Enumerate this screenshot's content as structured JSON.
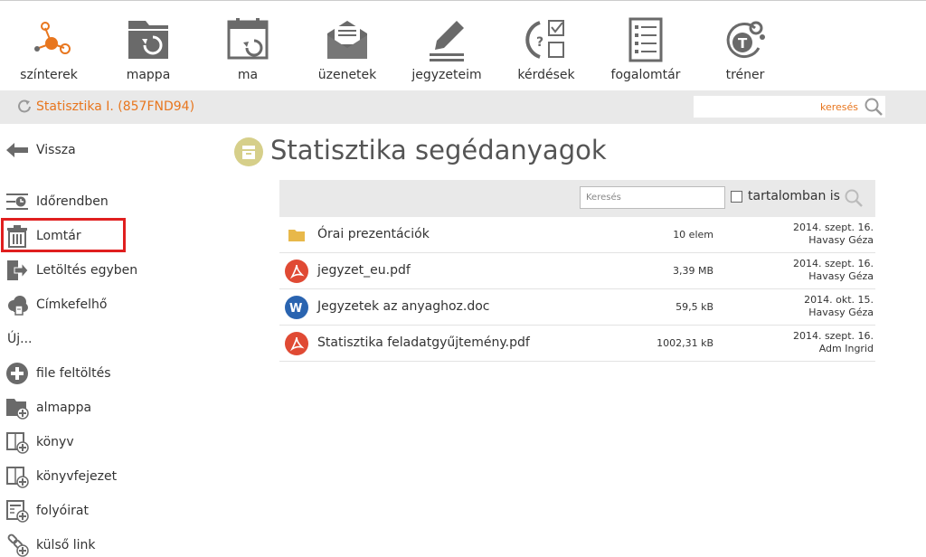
{
  "topnav": [
    {
      "id": "szinterek",
      "label": "színterek",
      "icon": "molecule-icon"
    },
    {
      "id": "mappa",
      "label": "mappa",
      "icon": "folder-refresh-icon"
    },
    {
      "id": "ma",
      "label": "ma",
      "icon": "calendar-icon"
    },
    {
      "id": "uzenetek",
      "label": "üzenetek",
      "icon": "envelope-icon"
    },
    {
      "id": "jegyzeteim",
      "label": "jegyzeteim",
      "icon": "pencil-icon"
    },
    {
      "id": "kerdesek",
      "label": "kérdések",
      "icon": "question-check-icon"
    },
    {
      "id": "fogalomtar",
      "label": "fogalomtár",
      "icon": "list-icon"
    },
    {
      "id": "trener",
      "label": "tréner",
      "icon": "trainer-icon"
    }
  ],
  "breadcrumb": {
    "course": "Statisztika I. (857FND94)"
  },
  "topsearch": {
    "placeholder": "keresés"
  },
  "sidebar": {
    "back": "Vissza",
    "timeline": "Időrendben",
    "trash": "Lomtár",
    "download": "Letöltés egyben",
    "tagcloud": "Címkefelhő",
    "new_heading": "Új...",
    "upload": "file feltöltés",
    "subfolder": "almappa",
    "book": "könyv",
    "chapter": "könyvfejezet",
    "journal": "folyóirat",
    "link": "külső link"
  },
  "page": {
    "title": "Statisztika segédanyagok"
  },
  "toolbar": {
    "search_placeholder": "Keresés",
    "content_label": "tartalomban is"
  },
  "files": [
    {
      "type": "folder",
      "name": "Órai prezentációk",
      "size": "10 elem",
      "date": "2014. szept. 16.",
      "owner": "Havasy Géza"
    },
    {
      "type": "pdf",
      "name": "jegyzet_eu.pdf",
      "size": "3,39 MB",
      "date": "2014. szept. 16.",
      "owner": "Havasy Géza"
    },
    {
      "type": "doc",
      "name": "Jegyzetek az anyaghoz.doc",
      "size": "59,5 kB",
      "date": "2014. okt. 15.",
      "owner": "Havasy Géza"
    },
    {
      "type": "pdf",
      "name": "Statisztika feladatgyűjtemény.pdf",
      "size": "1002,31 kB",
      "date": "2014. szept. 16.",
      "owner": "Adm Ingrid"
    }
  ],
  "colors": {
    "accent": "#e8761e",
    "grey": "#6a6a6a",
    "highlight": "#e01f1f",
    "pdf": "#e04a34",
    "word": "#2a64b0",
    "folder": "#e8b84a"
  }
}
